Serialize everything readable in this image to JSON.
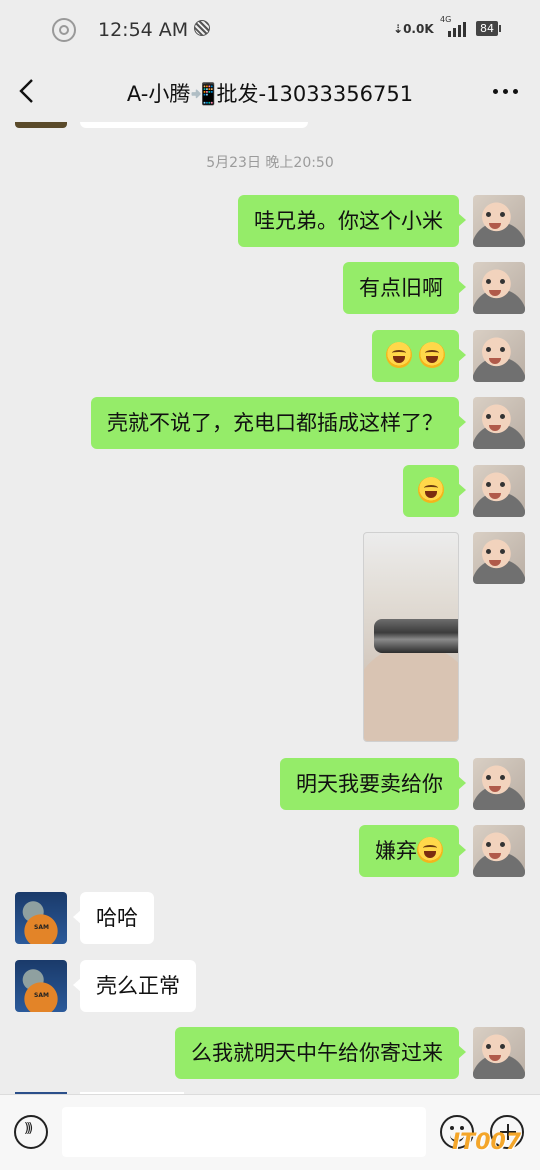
{
  "status_bar": {
    "time": "12:54 AM",
    "net_speed": "0.0K",
    "network": "4G",
    "battery": "84"
  },
  "header": {
    "title": "A-小腾📲批发-13033356751"
  },
  "chat": {
    "timestamp": "5月23日 晚上20:50",
    "messages": [
      {
        "side": "right",
        "text": "哇兄弟。你这个小米"
      },
      {
        "side": "right",
        "text": "有点旧啊"
      },
      {
        "side": "right",
        "text": "",
        "emoji": [
          "face-with-tears-of-joy-icon",
          "face-with-tears-of-joy-icon"
        ]
      },
      {
        "side": "right",
        "text": "壳就不说了，充电口都插成这样了？"
      },
      {
        "side": "right",
        "text": "",
        "emoji": [
          "face-with-tears-of-joy-icon"
        ]
      },
      {
        "side": "right",
        "type": "image"
      },
      {
        "side": "right",
        "text": "明天我要卖给你"
      },
      {
        "side": "right",
        "text": "嫌弃",
        "emoji": [
          "face-with-tears-of-joy-icon"
        ]
      },
      {
        "side": "left",
        "text": "哈哈"
      },
      {
        "side": "left",
        "text": "壳么正常"
      },
      {
        "side": "right",
        "text": "么我就明天中午给你寄过来"
      }
    ]
  },
  "input": {
    "value": "",
    "placeholder": ""
  },
  "watermark": "IT007"
}
